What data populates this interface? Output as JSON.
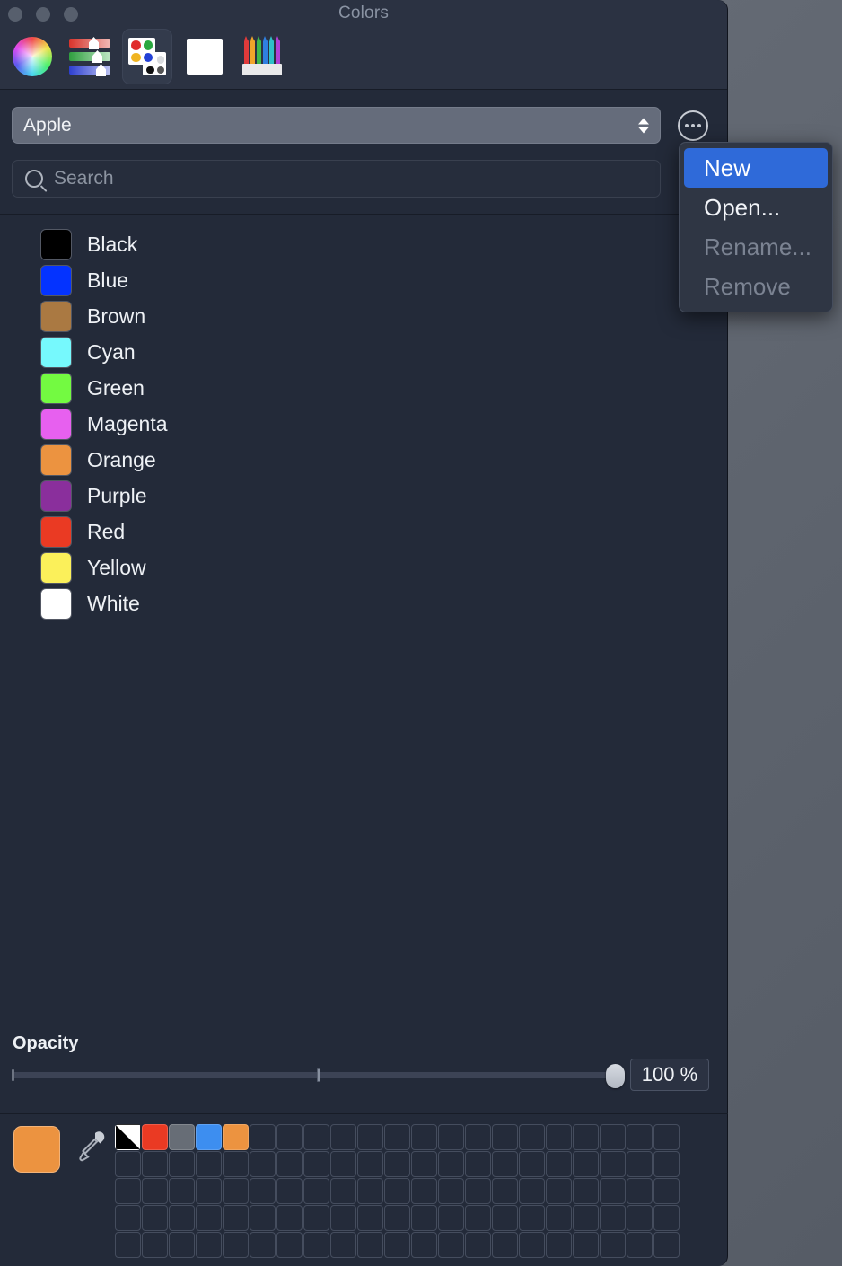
{
  "window": {
    "title": "Colors",
    "traffic_lights": [
      "close-button",
      "minimize-button",
      "zoom-button"
    ]
  },
  "toolbar": {
    "items": [
      {
        "name": "color-wheel-tab",
        "icon": "color-wheel-icon",
        "selected": false
      },
      {
        "name": "color-sliders-tab",
        "icon": "sliders-icon",
        "selected": false
      },
      {
        "name": "color-palettes-tab",
        "icon": "palette-icon",
        "selected": true
      },
      {
        "name": "image-palettes-tab",
        "icon": "image-icon",
        "selected": false
      },
      {
        "name": "pencils-tab",
        "icon": "pencils-icon",
        "selected": false
      }
    ]
  },
  "palette_select": {
    "value": "Apple",
    "options": [
      "Apple"
    ]
  },
  "options_button": {
    "icon": "ellipsis-icon",
    "label": "..."
  },
  "search": {
    "placeholder": "Search",
    "value": "",
    "icon": "search-icon"
  },
  "menu": {
    "items": [
      {
        "label": "New",
        "state": "highlighted"
      },
      {
        "label": "Open...",
        "state": "enabled"
      },
      {
        "label": "Rename...",
        "state": "disabled"
      },
      {
        "label": "Remove",
        "state": "disabled"
      }
    ]
  },
  "colors": [
    {
      "name": "Black",
      "hex": "#000000"
    },
    {
      "name": "Blue",
      "hex": "#0433ff"
    },
    {
      "name": "Brown",
      "hex": "#aa7942"
    },
    {
      "name": "Cyan",
      "hex": "#76f9fd"
    },
    {
      "name": "Green",
      "hex": "#73fa41"
    },
    {
      "name": "Magenta",
      "hex": "#e760ef"
    },
    {
      "name": "Orange",
      "hex": "#ec9340"
    },
    {
      "name": "Purple",
      "hex": "#8a2f9c"
    },
    {
      "name": "Red",
      "hex": "#ea3a23"
    },
    {
      "name": "Yellow",
      "hex": "#fbf05a"
    },
    {
      "name": "White",
      "hex": "#ffffff"
    }
  ],
  "opacity": {
    "label": "Opacity",
    "value": "100 %",
    "percent": 100,
    "min": 0,
    "max": 100
  },
  "footer": {
    "current_color": "#ec9340",
    "eyedropper": "eyedropper-icon",
    "swatch_grid": {
      "columns": 21,
      "rows": 5,
      "filled": [
        {
          "index": 0,
          "hex": "bw",
          "label": "black-white"
        },
        {
          "index": 1,
          "hex": "#ea3a23"
        },
        {
          "index": 2,
          "hex": "#676d76"
        },
        {
          "index": 3,
          "hex": "#3d8ef0"
        },
        {
          "index": 4,
          "hex": "#ec9340"
        }
      ]
    }
  },
  "accent": "#2f6ad9"
}
